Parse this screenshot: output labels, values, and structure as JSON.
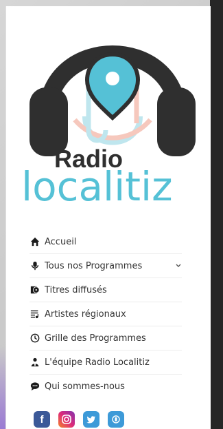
{
  "brand": {
    "line1": "Radio",
    "line2": "localitiz",
    "colors": {
      "headphones": "#2f2f2f",
      "accent_teal": "#55c1d6",
      "accent_salmon": "#f27d6a",
      "text_dark": "#333333"
    }
  },
  "menu": [
    {
      "icon": "home-icon",
      "label": "Accueil"
    },
    {
      "icon": "microphone-icon",
      "label": "Tous nos Programmes",
      "has_dropdown": true
    },
    {
      "icon": "record-icon",
      "label": "Titres diffusés"
    },
    {
      "icon": "playlist-icon",
      "label": "Artistes régionaux"
    },
    {
      "icon": "clock-icon",
      "label": "Grille des Programmes"
    },
    {
      "icon": "team-icon",
      "label": "L'équipe Radio Localitiz"
    },
    {
      "icon": "chat-icon",
      "label": "Qui sommes-nous"
    }
  ],
  "social": [
    {
      "icon": "facebook-icon",
      "label": "f"
    },
    {
      "icon": "instagram-icon"
    },
    {
      "icon": "twitter-icon"
    },
    {
      "icon": "podcast-icon"
    }
  ]
}
